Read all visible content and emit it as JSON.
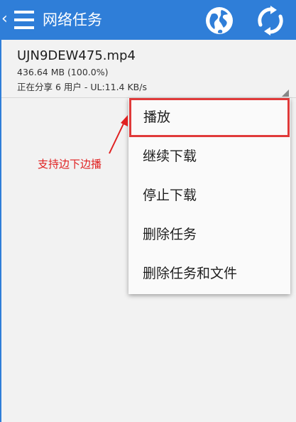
{
  "appbar": {
    "title": "网络任务",
    "background_color": "#2f7ed8",
    "icons": [
      "back-chevron-icon",
      "menu-icon",
      "globe-icon",
      "sync-icon"
    ]
  },
  "task": {
    "name": "UJN9DEW475.mp4",
    "size": "436.64 MB  (100.0%)",
    "status": "正在分享  6 用户 - UL:11.4 KB/s"
  },
  "context_menu": {
    "items": [
      {
        "label": "播放"
      },
      {
        "label": "继续下载"
      },
      {
        "label": "停止下载"
      },
      {
        "label": "删除任务"
      },
      {
        "label": "删除任务和文件"
      }
    ],
    "highlighted_index": 0,
    "highlight_color": "#e03a3a"
  },
  "annotation": {
    "text": "支持边下边播",
    "color": "#e02020"
  }
}
